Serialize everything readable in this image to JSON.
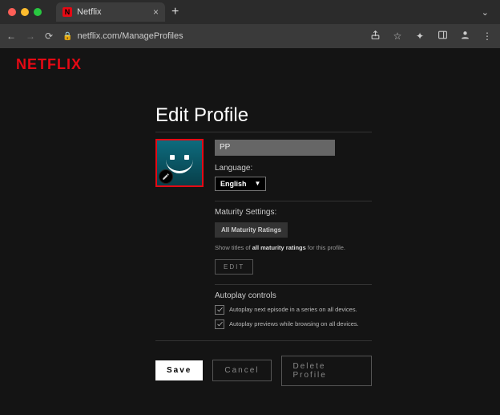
{
  "browser": {
    "tab_title": "Netflix",
    "url": "netflix.com/ManageProfiles"
  },
  "logo": "NETFLIX",
  "title": "Edit Profile",
  "profile_name": "PP",
  "language": {
    "label": "Language:",
    "value": "English"
  },
  "maturity": {
    "heading": "Maturity Settings:",
    "level": "All Maturity Ratings",
    "hint_prefix": "Show titles of ",
    "hint_bold": "all maturity ratings",
    "hint_suffix": " for this profile.",
    "edit_label": "Edit"
  },
  "autoplay": {
    "heading": "Autoplay controls",
    "opt1": "Autoplay next episode in a series on all devices.",
    "opt2": "Autoplay previews while browsing on all devices."
  },
  "buttons": {
    "save": "Save",
    "cancel": "Cancel",
    "delete": "Delete Profile"
  }
}
